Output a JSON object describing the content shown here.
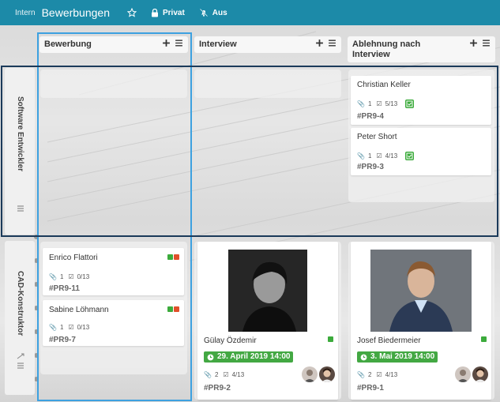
{
  "topbar": {
    "intern": "Intern",
    "title": "Bewerbungen",
    "privat": "Privat",
    "aus": "Aus"
  },
  "columns": [
    {
      "label": "Bewerbung"
    },
    {
      "label": "Interview"
    },
    {
      "label": "Ablehnung nach Interview"
    }
  ],
  "lanes": [
    {
      "label": "Software Entwickler"
    },
    {
      "label": "CAD-Konstruktor"
    }
  ],
  "cards": {
    "christian": {
      "name": "Christian Keller",
      "attach": "1",
      "tasks": "5/13",
      "key": "#PR9-4"
    },
    "peter": {
      "name": "Peter Short",
      "attach": "1",
      "tasks": "4/13",
      "key": "#PR9-3"
    },
    "enrico": {
      "name": "Enrico Flattori",
      "attach": "1",
      "tasks": "0/13",
      "key": "#PR9-11"
    },
    "sabine": {
      "name": "Sabine Löhmann",
      "attach": "1",
      "tasks": "0/13",
      "key": "#PR9-7"
    },
    "guelay": {
      "name": "Gülay Özdemir",
      "date": "29. April 2019 14:00",
      "attach": "2",
      "tasks": "4/13",
      "key": "#PR9-2"
    },
    "josef": {
      "name": "Josef Biedermeier",
      "date": "3. Mai 2019 14:00",
      "attach": "2",
      "tasks": "4/13",
      "key": "#PR9-1"
    }
  },
  "colors": {
    "topbar": "#1c8aa8",
    "green": "#3cab3c",
    "red": "#e0502a",
    "date_green": "#43a843"
  },
  "icons": [
    "star-icon",
    "lock-icon",
    "bell-off-icon",
    "plus-icon",
    "menu-icon",
    "paperclip-icon",
    "checkbox-icon"
  ]
}
